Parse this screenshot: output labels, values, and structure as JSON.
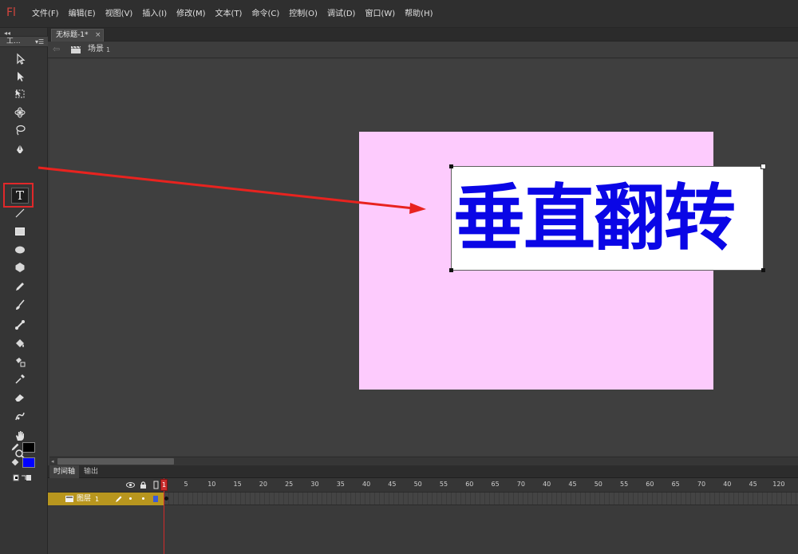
{
  "app": {
    "logo": "Fl",
    "menu": [
      "文件(F)",
      "编辑(E)",
      "视图(V)",
      "插入(I)",
      "修改(M)",
      "文本(T)",
      "命令(C)",
      "控制(O)",
      "调试(D)",
      "窗口(W)",
      "帮助(H)"
    ]
  },
  "tools_panel": {
    "collapse_glyph": "◂◂",
    "title": "工...",
    "menu_glyph": "▾☰",
    "active_tool": "text-tool",
    "text_tool_glyph": "T",
    "stroke_color": "#000000",
    "fill_color": "#0000ff",
    "highlight_color": "#e0282a"
  },
  "document": {
    "tab_title": "无标题-1*",
    "tab_close": "×",
    "scene_label": "场景",
    "scene_number": "1",
    "stage_color": "#fdcbfd",
    "stage_text": "垂直翻转",
    "text_color": "#0a06e6"
  },
  "timeline": {
    "tabs": [
      "时间轴",
      "输出"
    ],
    "active_tab": "时间轴",
    "ruler_marks": [
      "1",
      "5",
      "10",
      "15",
      "20",
      "25",
      "30",
      "35",
      "40",
      "45",
      "50",
      "55",
      "60",
      "65",
      "70",
      "40",
      "45",
      "50",
      "55",
      "60",
      "65",
      "70",
      "40",
      "45",
      "120"
    ],
    "layer": {
      "name": "图层",
      "number": "1",
      "color": "#3a5bd8"
    },
    "playhead_frame": "1",
    "layer_row_color": "#b8961e"
  }
}
